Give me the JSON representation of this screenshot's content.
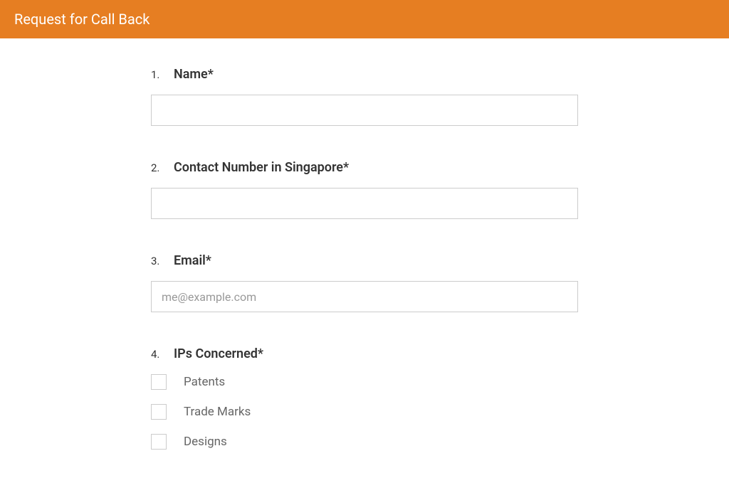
{
  "header": {
    "title": "Request for Call Back"
  },
  "form": {
    "q1": {
      "number": "1.",
      "label": "Name*",
      "value": "",
      "placeholder": ""
    },
    "q2": {
      "number": "2.",
      "label": "Contact Number in Singapore*",
      "value": "",
      "placeholder": ""
    },
    "q3": {
      "number": "3.",
      "label": "Email*",
      "value": "",
      "placeholder": "me@example.com"
    },
    "q4": {
      "number": "4.",
      "label": "IPs Concerned*",
      "options": [
        "Patents",
        "Trade Marks",
        "Designs"
      ]
    }
  }
}
